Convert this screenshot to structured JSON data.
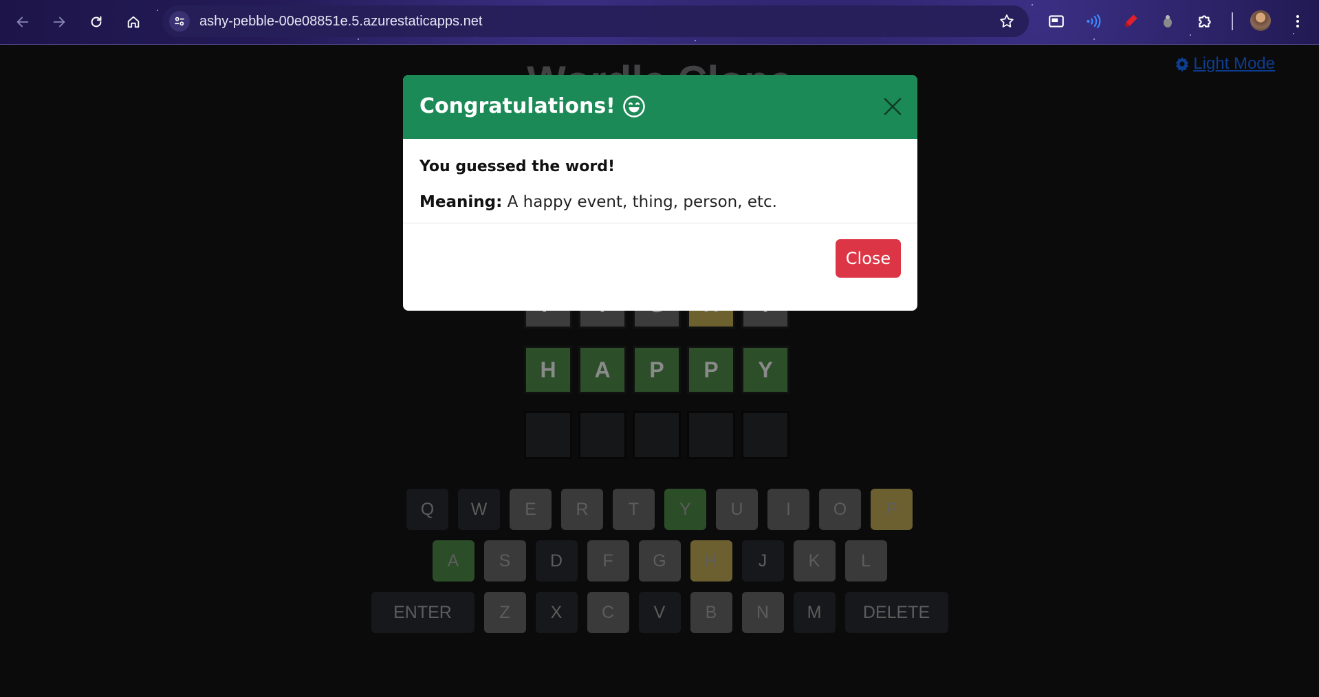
{
  "browser": {
    "url": "ashy-pebble-00e08851e.5.azurestaticapps.net"
  },
  "page": {
    "title": "Wordle Clone",
    "theme_toggle_label": "Light Mode"
  },
  "modal": {
    "title": "Congratulations!",
    "message": "You guessed the word!",
    "meaning_label": "Meaning:",
    "meaning_text": "A happy event, thing, person, etc.",
    "close_button": "Close"
  },
  "board": {
    "rows": [
      {
        "letters": [
          "F",
          "I",
          "G",
          "H",
          "T"
        ],
        "states": [
          "gray",
          "gray",
          "gray",
          "yellow",
          "gray"
        ]
      },
      {
        "letters": [
          "H",
          "A",
          "P",
          "P",
          "Y"
        ],
        "states": [
          "green",
          "green",
          "green",
          "green",
          "green"
        ]
      },
      {
        "letters": [
          "",
          "",
          "",
          "",
          ""
        ],
        "states": [
          "empty",
          "empty",
          "empty",
          "empty",
          "empty"
        ]
      }
    ]
  },
  "keyboard": {
    "row1": [
      {
        "key": "Q",
        "state": "dark"
      },
      {
        "key": "W",
        "state": "dark"
      },
      {
        "key": "E",
        "state": "gray"
      },
      {
        "key": "R",
        "state": "gray"
      },
      {
        "key": "T",
        "state": "gray"
      },
      {
        "key": "Y",
        "state": "green"
      },
      {
        "key": "U",
        "state": "gray"
      },
      {
        "key": "I",
        "state": "gray"
      },
      {
        "key": "O",
        "state": "gray"
      },
      {
        "key": "P",
        "state": "yellow"
      }
    ],
    "row2": [
      {
        "key": "A",
        "state": "green"
      },
      {
        "key": "S",
        "state": "gray"
      },
      {
        "key": "D",
        "state": "dark"
      },
      {
        "key": "F",
        "state": "gray"
      },
      {
        "key": "G",
        "state": "gray"
      },
      {
        "key": "H",
        "state": "yellow"
      },
      {
        "key": "J",
        "state": "dark"
      },
      {
        "key": "K",
        "state": "gray"
      },
      {
        "key": "L",
        "state": "gray"
      }
    ],
    "row3": [
      {
        "key": "ENTER",
        "state": "dark",
        "wide": true
      },
      {
        "key": "Z",
        "state": "gray"
      },
      {
        "key": "X",
        "state": "dark"
      },
      {
        "key": "C",
        "state": "gray"
      },
      {
        "key": "V",
        "state": "dark"
      },
      {
        "key": "B",
        "state": "gray"
      },
      {
        "key": "N",
        "state": "gray"
      },
      {
        "key": "M",
        "state": "dark"
      },
      {
        "key": "DELETE",
        "state": "dark",
        "wide": true
      }
    ]
  },
  "colors": {
    "modal_header": "#1c8a56",
    "close_button": "#dc3545",
    "tile_green": "#2c4f2a",
    "tile_yellow": "#6d6130"
  }
}
